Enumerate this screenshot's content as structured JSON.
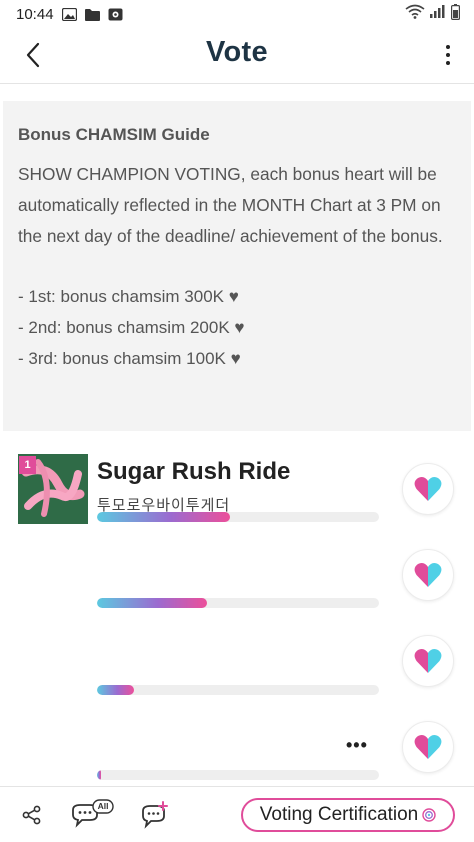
{
  "status_bar": {
    "time": "10:44"
  },
  "header": {
    "title": "Vote"
  },
  "guide": {
    "title": "Bonus CHAMSIM Guide",
    "body": "SHOW CHAMPION VOTING, each bonus heart will be automatically reflected in the MONTH Chart at 3 PM on the next day of the deadline/ achievement of the bonus.",
    "items": [
      "- 1st: bonus chamsim 300K ♥",
      "- 2nd: bonus chamsim 200K ♥",
      "- 3rd: bonus chamsim 100K ♥"
    ]
  },
  "votes": [
    {
      "rank": "1",
      "title": "Sugar Rush Ride",
      "artist": "투모로우바이투게더",
      "progress": 0.47
    },
    {
      "title": "",
      "artist": "",
      "progress": 0.39
    },
    {
      "title": "",
      "artist": "",
      "progress": 0.13
    },
    {
      "title": "",
      "artist": "",
      "progress": 0.01
    }
  ],
  "bottom_bar": {
    "all_badge": "All",
    "certification_label": "Voting Certification"
  },
  "colors": {
    "accent_pink": "#e04c9a",
    "accent_cyan": "#5cc9e0",
    "title_navy": "#1e3444",
    "guide_bg": "#f3f3f3"
  },
  "icons": {
    "back": "chevron-left-icon",
    "more": "more-vertical-icon",
    "heart": "heart-icon",
    "share": "share-icon",
    "comments_all": "chat-all-icon",
    "add_comment": "chat-add-icon"
  }
}
